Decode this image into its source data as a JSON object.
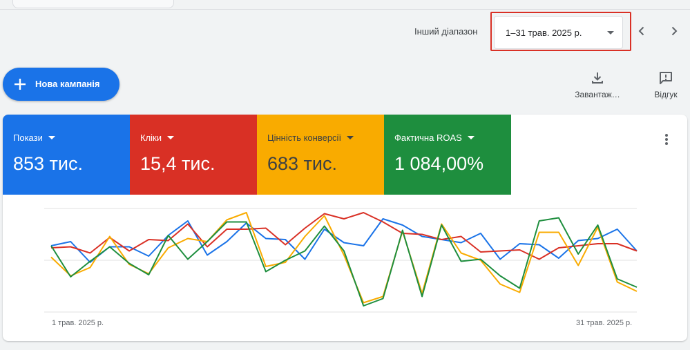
{
  "header": {
    "range_label": "Інший діапазон",
    "date_range": "1–31 трав. 2025 р.",
    "prev_icon": "chevron-left-icon",
    "next_icon": "chevron-right-icon"
  },
  "actions": {
    "new_campaign": "Нова кампанія",
    "download": "Завантаж…",
    "feedback": "Відгук"
  },
  "metrics": [
    {
      "name": "Покази",
      "value": "853 тис.",
      "color": "#1a73e8",
      "text": "#ffffff"
    },
    {
      "name": "Кліки",
      "value": "15,4 тис.",
      "color": "#d93025",
      "text": "#ffffff"
    },
    {
      "name": "Цінність конверсії",
      "value": "683 тис.",
      "color": "#f9ab00",
      "text": "#3c4043"
    },
    {
      "name": "Фактична ROAS",
      "value": "1 084,00%",
      "color": "#1e8e3e",
      "text": "#ffffff"
    }
  ],
  "chart_data": {
    "type": "line",
    "x_start_label": "1 трав. 2025 р.",
    "x_end_label": "31 трав. 2025 р.",
    "ylim": [
      0,
      100
    ],
    "grid": true,
    "series": [
      {
        "color": "#1a73e8",
        "values": [
          64,
          68,
          48,
          63,
          63,
          54,
          74,
          88,
          55,
          68,
          86,
          71,
          70,
          51,
          80,
          67,
          64,
          90,
          84,
          73,
          70,
          67,
          76,
          51,
          66,
          65,
          52,
          69,
          71,
          80,
          59
        ]
      },
      {
        "color": "#d93025",
        "values": [
          62,
          63,
          57,
          72,
          59,
          70,
          69,
          85,
          63,
          80,
          80,
          81,
          65,
          81,
          95,
          90,
          96,
          87,
          76,
          75,
          70,
          73,
          58,
          59,
          60,
          51,
          62,
          64,
          66,
          66,
          59
        ]
      },
      {
        "color": "#f9ab00",
        "values": [
          53,
          35,
          43,
          73,
          46,
          37,
          62,
          71,
          68,
          89,
          96,
          44,
          48,
          73,
          93,
          55,
          9,
          15,
          78,
          18,
          85,
          57,
          50,
          27,
          19,
          77,
          77,
          45,
          82,
          29,
          20
        ]
      },
      {
        "color": "#1e8e3e",
        "values": [
          64,
          34,
          49,
          63,
          47,
          36,
          74,
          51,
          68,
          87,
          87,
          39,
          50,
          59,
          83,
          59,
          6,
          13,
          79,
          15,
          84,
          49,
          51,
          35,
          23,
          88,
          91,
          56,
          84,
          32,
          24
        ]
      }
    ]
  }
}
